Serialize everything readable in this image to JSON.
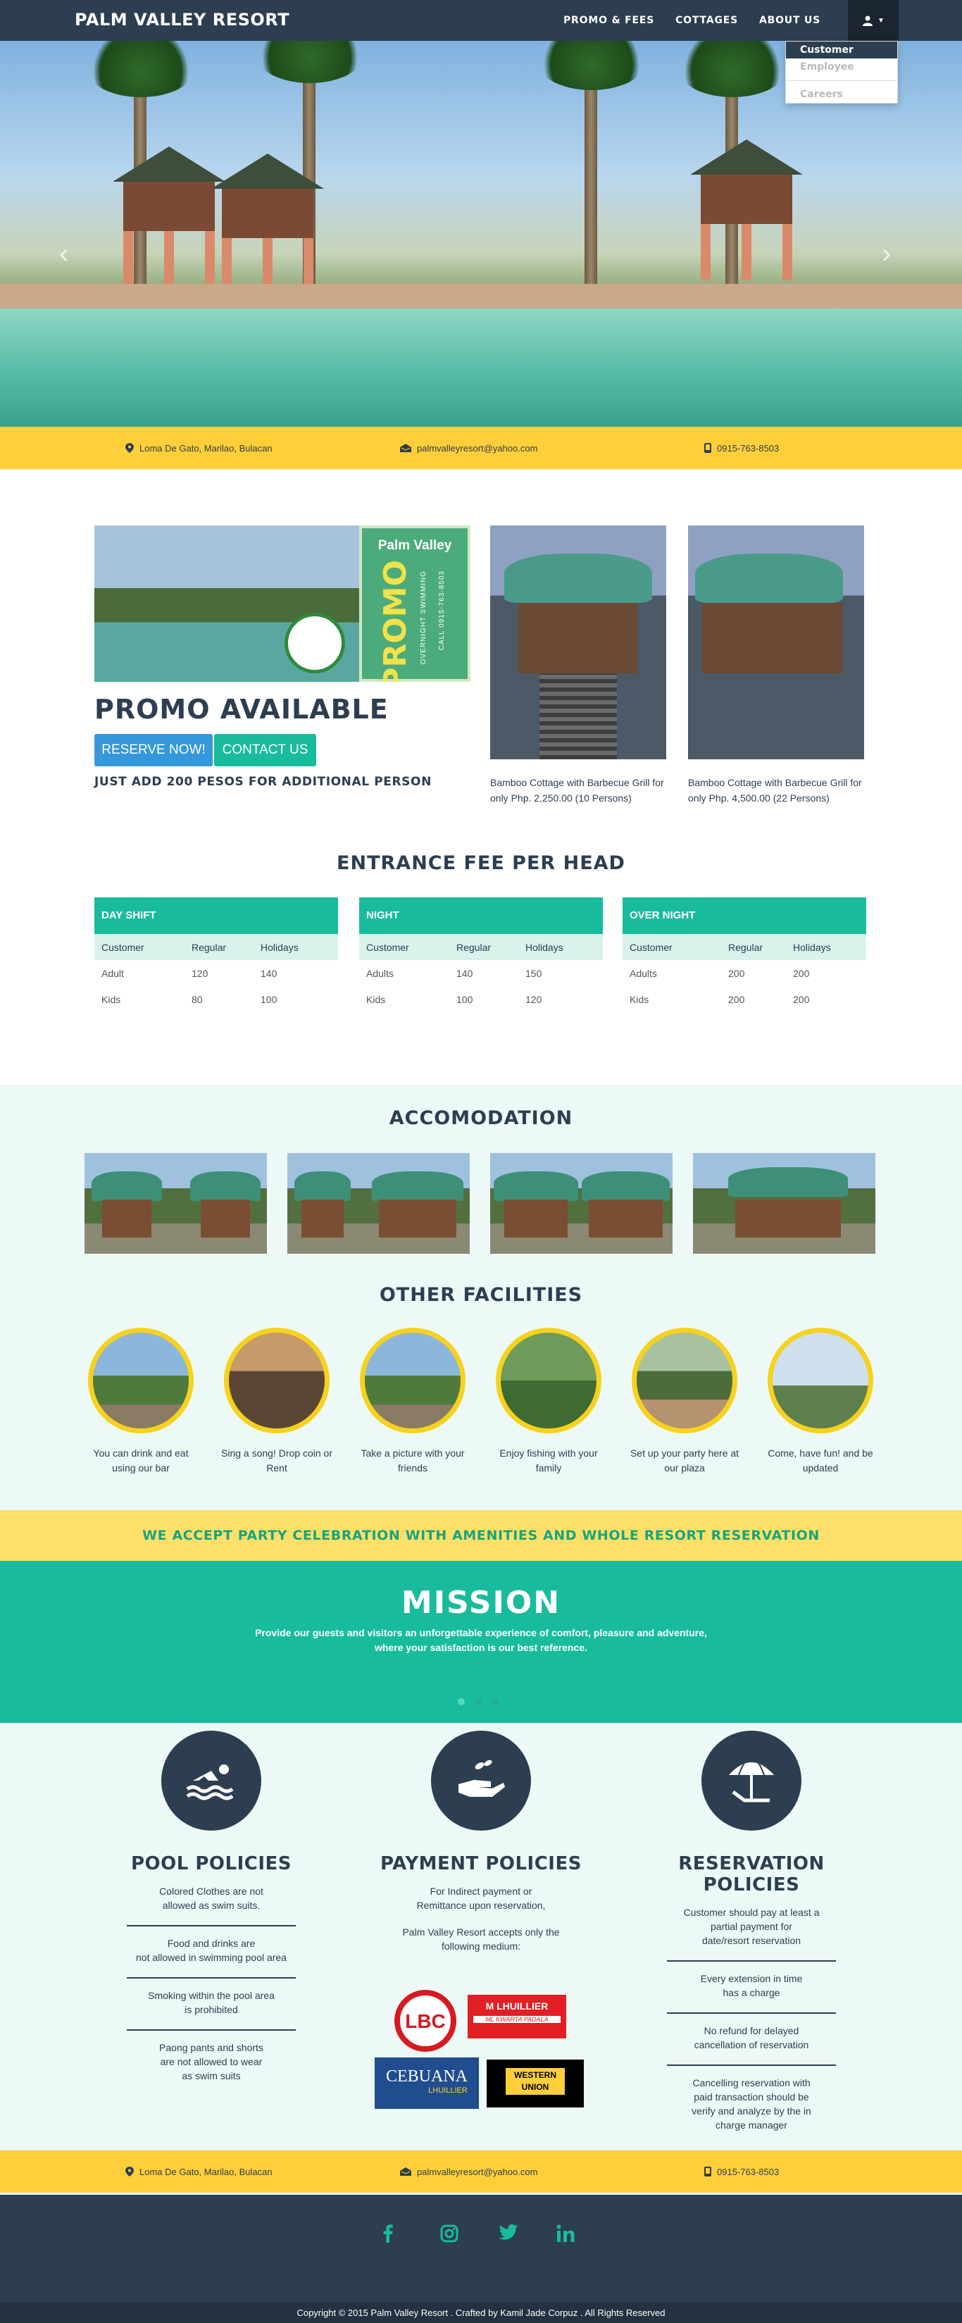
{
  "nav": {
    "brand": "PALM VALLEY RESORT",
    "links": [
      "PROMO & FEES",
      "COTTAGES",
      "ABOUT US"
    ],
    "user_icon": "user-icon",
    "dropdown": [
      "Customer",
      "Employee",
      "Careers"
    ]
  },
  "contact": {
    "address": "Loma De Gato, Marilao, Bulacan",
    "email": "palmvalleyresort@yahoo.com",
    "phone": "0915-763-8503"
  },
  "promo": {
    "sign_title": "Palm Valley",
    "sign_big": "PROMO",
    "sign_small": "OVERNIGHT SWIMMING",
    "sign_call": "CALL 0915-763-8503",
    "heading": "PROMO AVAILABLE",
    "reserve_btn": "RESERVE NOW!",
    "contact_btn": "CONTACT US",
    "note": "JUST ADD 200 PESOS FOR ADDITIONAL PERSON",
    "cottages": [
      {
        "caption": "Bamboo Cottage with Barbecue Grill for only Php. 2,250.00 (10 Persons)"
      },
      {
        "caption": "Bamboo Cottage with Barbecue Grill for only Php. 4,500.00 (22 Persons)"
      }
    ]
  },
  "fees": {
    "title": "ENTRANCE FEE PER HEAD",
    "tables": [
      {
        "name": "DAY SHIFT",
        "cols": [
          "Customer",
          "Regular",
          "Holidays"
        ],
        "rows": [
          [
            "Adult",
            "120",
            "140"
          ],
          [
            "Kids",
            "80",
            "100"
          ]
        ]
      },
      {
        "name": "NIGHT",
        "cols": [
          "Customer",
          "Regular",
          "Holidays"
        ],
        "rows": [
          [
            "Adults",
            "140",
            "150"
          ],
          [
            "Kids",
            "100",
            "120"
          ]
        ]
      },
      {
        "name": "OVER NIGHT",
        "cols": [
          "Customer",
          "Regular",
          "Holidays"
        ],
        "rows": [
          [
            "Adults",
            "200",
            "200"
          ],
          [
            "Kids",
            "200",
            "200"
          ]
        ]
      }
    ]
  },
  "accommodation": {
    "title": "ACCOMODATION"
  },
  "facilities": {
    "title": "OTHER FACILITIES",
    "items": [
      {
        "caption": "You can drink and eat using our bar"
      },
      {
        "caption": "Sing a song! Drop coin or Rent"
      },
      {
        "caption": "Take a picture with your friends"
      },
      {
        "caption": "Enjoy fishing with your family"
      },
      {
        "caption": "Set up your party here at our plaza"
      },
      {
        "caption": "Come, have fun! and be updated"
      }
    ]
  },
  "banner": "WE ACCEPT PARTY CELEBRATION WITH AMENITIES AND WHOLE RESORT RESERVATION",
  "mission": {
    "title": "MISSION",
    "line1": "Provide our guests and visitors an unforgettable experience of comfort, pleasure and adventure,",
    "line2": "where your satisfaction is our best reference."
  },
  "policies": {
    "pool": {
      "title": "POOL POLICIES",
      "items": [
        "Colored Clothes are not\nallowed as swim suits.",
        "Food and drinks are\nnot allowed in swimming pool area",
        "Smoking within the pool area\nis prohibited",
        "Paong pants and shorts\nare not allowed to wear\nas swim suits"
      ]
    },
    "payment": {
      "title": "PAYMENT POLICIES",
      "items": [
        "For Indirect payment or\nRemittance upon reservation,",
        "Palm Valley Resort accepts only the\nfollowing medium:"
      ],
      "logos": {
        "lbc": "LBC",
        "mlhuillier": "M LHUILLIER",
        "mlhuillier_sub": "ML KWARTA PADALA",
        "cebuana": "CEBUANA",
        "cebuana_sub": "LHUILLIER",
        "western": "WESTERN",
        "western_sub": "UNION"
      }
    },
    "reservation": {
      "title": "RESERVATION POLICIES",
      "items": [
        "Customer should pay at least a\npartial payment for\ndate/resort reservation",
        "Every extension in time\nhas a charge",
        "No refund for delayed\ncancellation of reservation",
        "Cancelling reservation with\npaid transaction should be\nverify and analyze by the in\ncharge manager"
      ]
    }
  },
  "footer": {
    "social": [
      "f",
      "ig",
      "tw",
      "in"
    ],
    "copyright": "Copyright © 2015 Palm Valley Resort . Crafted by Kamil Jade Corpuz . All Rights Reserved"
  },
  "colors": {
    "primary": "#2c3e50",
    "accent": "#18bc9c",
    "yellow": "#fecf3a",
    "blue": "#3498db"
  }
}
